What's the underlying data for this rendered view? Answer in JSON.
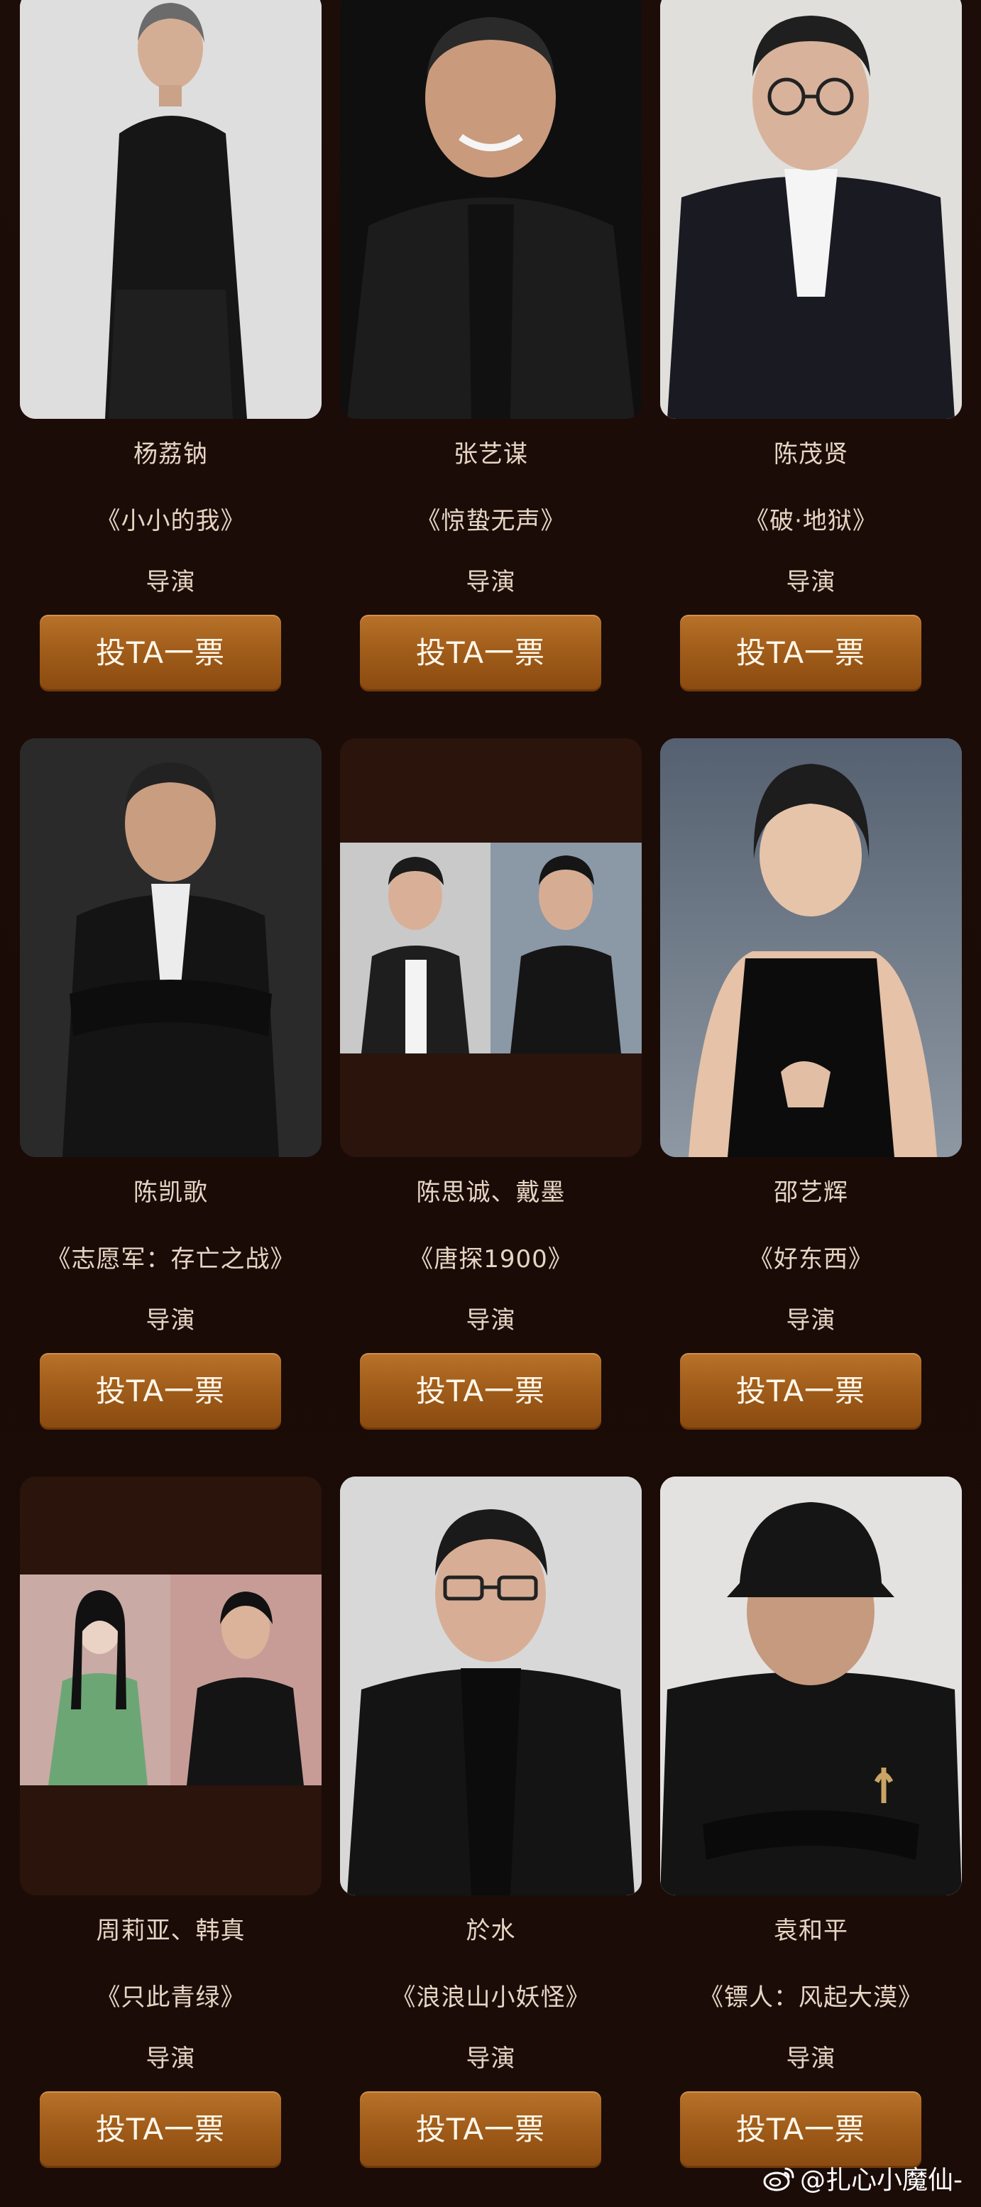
{
  "cards": [
    {
      "name": "杨荔钠",
      "film": "《小小的我》",
      "role": "导演",
      "vote": "投TA一票"
    },
    {
      "name": "张艺谋",
      "film": "《惊蛰无声》",
      "role": "导演",
      "vote": "投TA一票"
    },
    {
      "name": "陈茂贤",
      "film": "《破·地狱》",
      "role": "导演",
      "vote": "投TA一票"
    },
    {
      "name": "陈凯歌",
      "film": "《志愿军：存亡之战》",
      "role": "导演",
      "vote": "投TA一票"
    },
    {
      "name": "陈思诚、戴墨",
      "film": "《唐探1900》",
      "role": "导演",
      "vote": "投TA一票"
    },
    {
      "name": "邵艺辉",
      "film": "《好东西》",
      "role": "导演",
      "vote": "投TA一票"
    },
    {
      "name": "周莉亚、韩真",
      "film": "《只此青绿》",
      "role": "导演",
      "vote": "投TA一票"
    },
    {
      "name": "於水",
      "film": "《浪浪山小妖怪》",
      "role": "导演",
      "vote": "投TA一票"
    },
    {
      "name": "袁和平",
      "film": "《镖人：风起大漠》",
      "role": "导演",
      "vote": "投TA一票"
    }
  ],
  "watermark": {
    "text": "@扎心小魔仙-",
    "icon": "weibo-icon"
  },
  "colors": {
    "background": "#1b0c08",
    "button": "#a15d1a",
    "text": "#e6d5c3"
  }
}
